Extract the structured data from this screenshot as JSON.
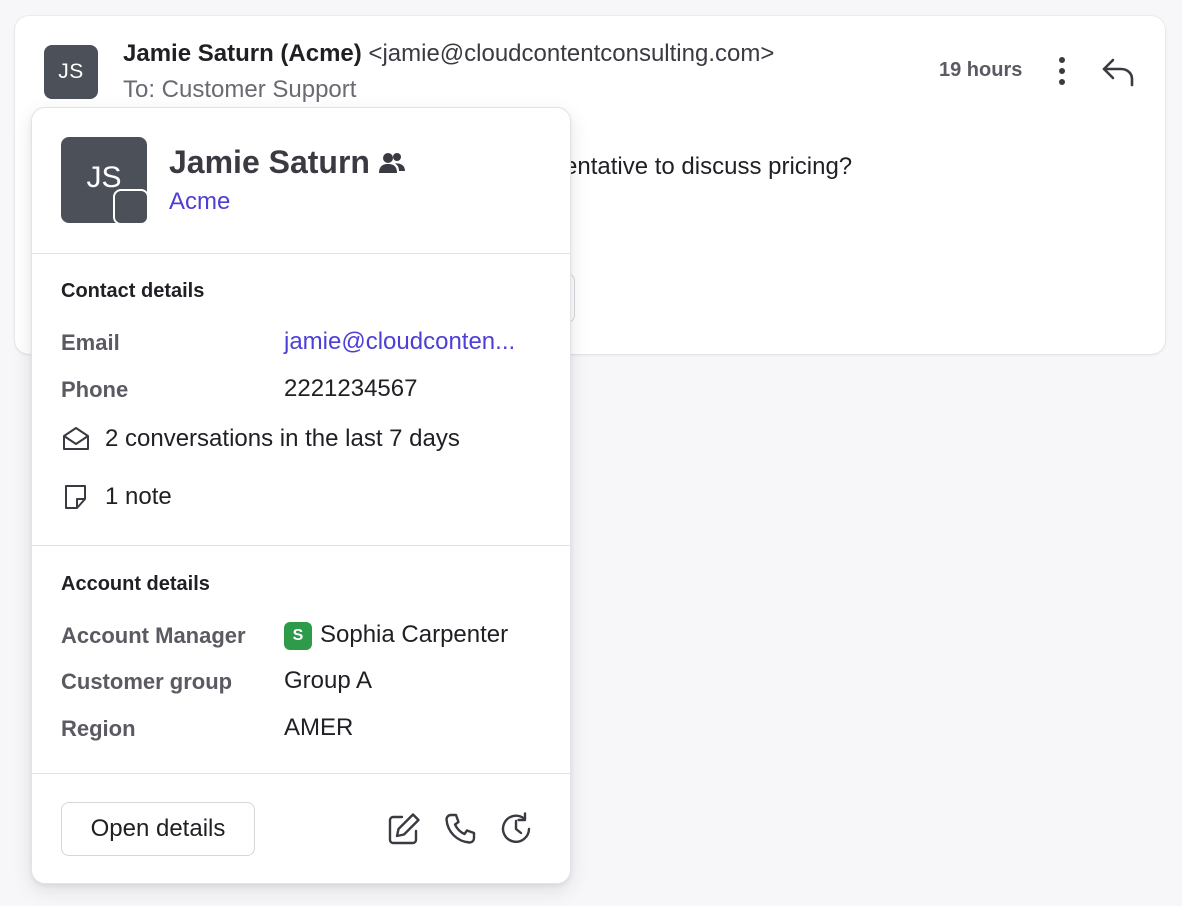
{
  "message": {
    "avatar_initials": "JS",
    "sender_name": "Jamie Saturn (Acme)",
    "sender_email": "<jamie@cloudcontentconsulting.com>",
    "to_line": "To: Customer Support",
    "timestamp": "19 hours",
    "body_visible_fragment": "sentative to discuss pricing?",
    "icons": {
      "more": "more-vertical-icon",
      "reply": "reply-icon"
    }
  },
  "popover": {
    "avatar_initials": "JS",
    "name": "Jamie Saturn",
    "name_icon": "contact-people-icon",
    "company": "Acme",
    "contact_details": {
      "title": "Contact details",
      "email_label": "Email",
      "email_value": "jamie@cloudconten...",
      "phone_label": "Phone",
      "phone_value": "2221234567",
      "conversations_text": "2 conversations in the last 7 days",
      "notes_text": "1 note"
    },
    "account_details": {
      "title": "Account details",
      "manager_label": "Account Manager",
      "manager_badge": "S",
      "manager_name": "Sophia Carpenter",
      "group_label": "Customer group",
      "group_value": "Group A",
      "region_label": "Region",
      "region_value": "AMER"
    },
    "footer": {
      "open_details_label": "Open details",
      "icons": [
        "edit-icon",
        "phone-icon",
        "history-icon"
      ]
    }
  },
  "colors": {
    "accent": "#4d3fd6",
    "avatar_bg": "#4c5059",
    "manager_badge": "#2e9b4a",
    "background": "#f7f6f9"
  }
}
